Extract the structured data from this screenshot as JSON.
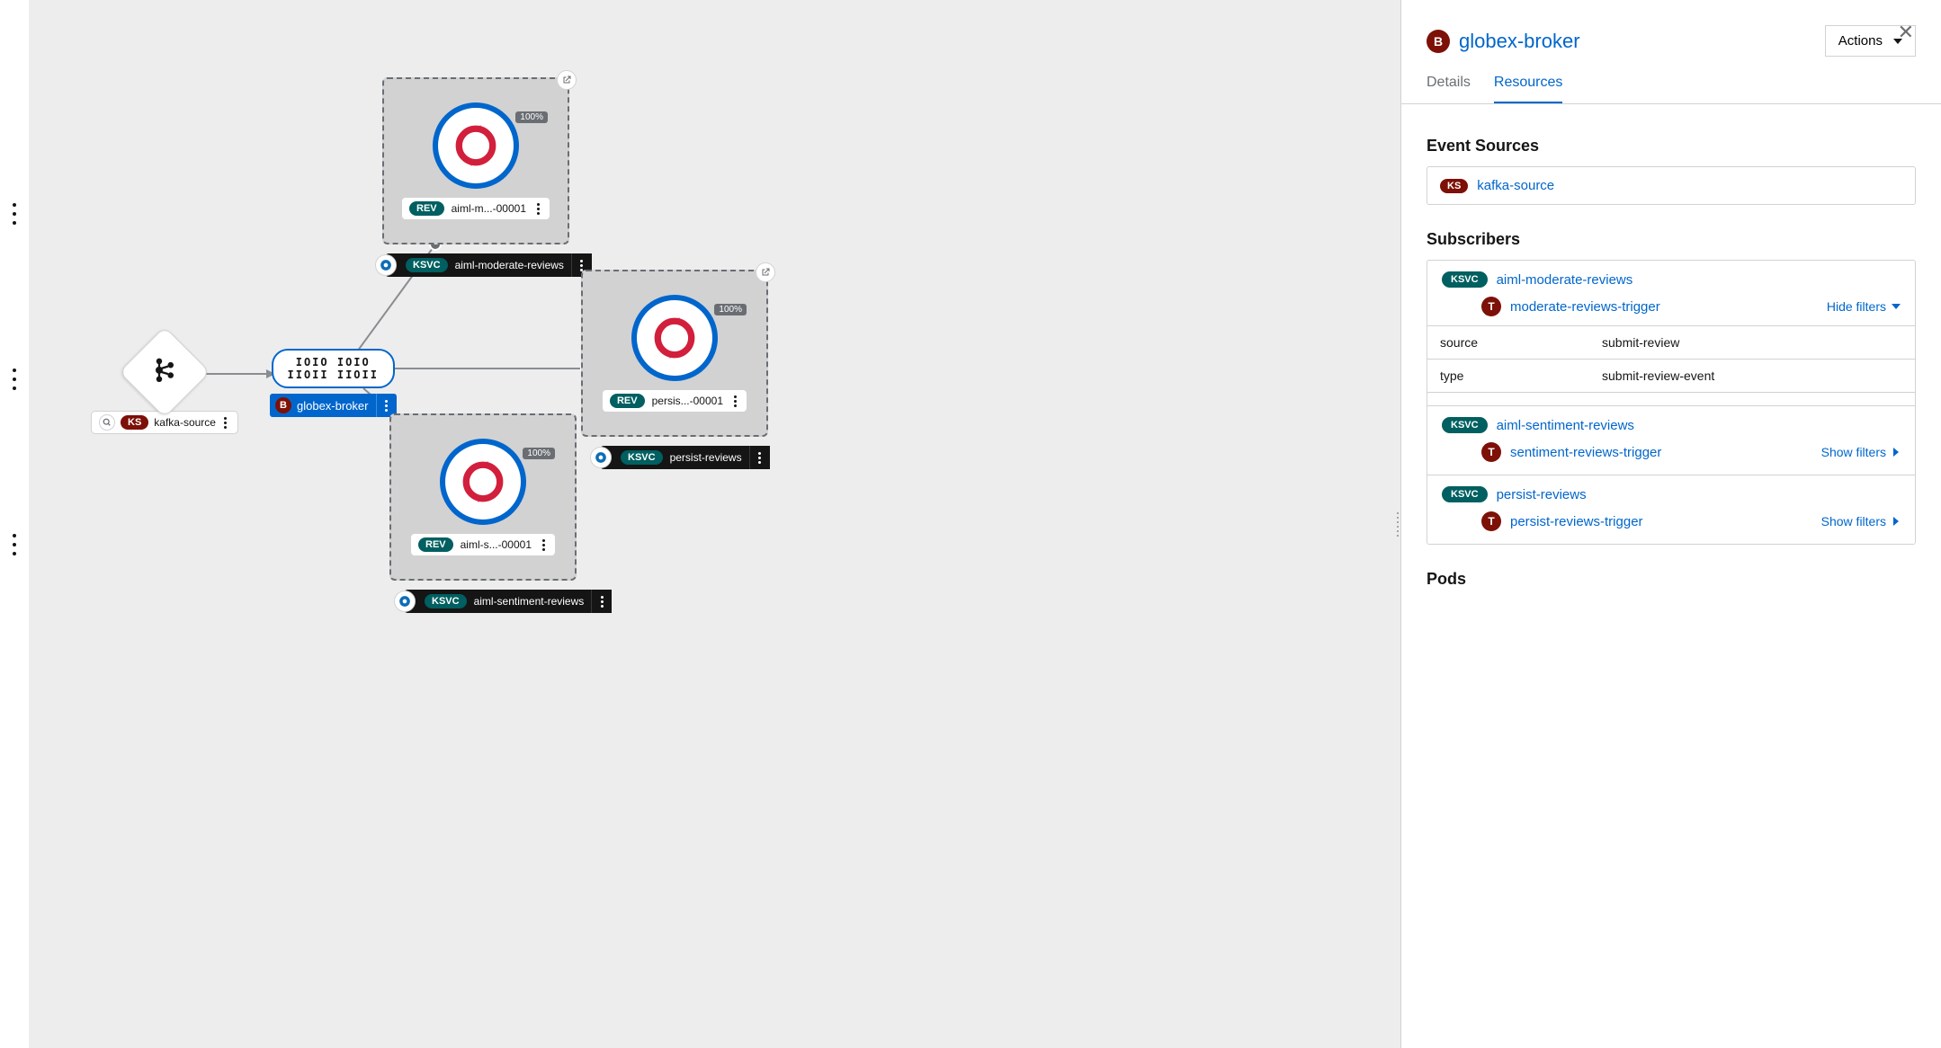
{
  "topology": {
    "kafka": {
      "label": "kafka-source",
      "badge": "KS"
    },
    "broker": {
      "label": "globex-broker",
      "badge": "B",
      "bits": "1010 1010\n11011 11011"
    },
    "services": [
      {
        "id": "moderate",
        "ksvc_label": "aiml-moderate-reviews",
        "rev_label": "aiml-m...-00001",
        "pct": "100%"
      },
      {
        "id": "persist",
        "ksvc_label": "persist-reviews",
        "rev_label": "persis...-00001",
        "pct": "100%"
      },
      {
        "id": "sentiment",
        "ksvc_label": "aiml-sentiment-reviews",
        "rev_label": "aiml-s...-00001",
        "pct": "100%"
      }
    ]
  },
  "panel": {
    "title": "globex-broker",
    "badge": "B",
    "actions_label": "Actions",
    "tabs": {
      "details": "Details",
      "resources": "Resources"
    },
    "sections": {
      "event_sources": "Event Sources",
      "subscribers": "Subscribers",
      "pods": "Pods"
    },
    "event_sources": [
      {
        "badge": "KS",
        "name": "kafka-source"
      }
    ],
    "filter_labels": {
      "hide": "Hide filters",
      "show": "Show filters"
    },
    "subscribers": [
      {
        "ksvc": "aiml-moderate-reviews",
        "trigger": "moderate-reviews-trigger",
        "expanded": true,
        "filters": [
          {
            "key": "source",
            "value": "submit-review"
          },
          {
            "key": "type",
            "value": "submit-review-event"
          }
        ]
      },
      {
        "ksvc": "aiml-sentiment-reviews",
        "trigger": "sentiment-reviews-trigger",
        "expanded": false
      },
      {
        "ksvc": "persist-reviews",
        "trigger": "persist-reviews-trigger",
        "expanded": false
      }
    ]
  }
}
